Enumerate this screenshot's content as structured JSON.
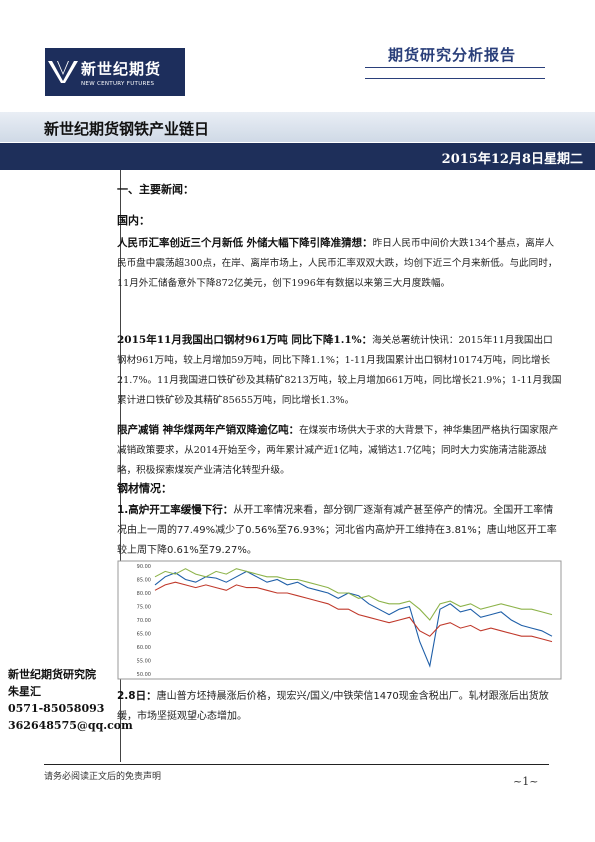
{
  "header": {
    "logo_cn": "新世纪期货",
    "logo_en": "NEW CENTURY FUTURES",
    "report_type": "期货研究分析报告"
  },
  "title": "新世纪期货钢铁产业链日",
  "date": "2015年12月8日星期二",
  "section1": {
    "heading": "一、主要新闻：",
    "domestic_label": "国内：",
    "news": [
      {
        "headline": "人民币汇率创近三个月新低 外储大幅下降引降准猜想：",
        "body": "昨日人民币中间价大跌134个基点，离岸人民币盘中震荡超300点，在岸、离岸市场上，人民币汇率双双大跌，均创下近三个月来新低。与此同时，11月外汇储备意外下降872亿美元，创下1996年有数据以来第三大月度跌幅。"
      },
      {
        "headline": "2015年11月我国出口钢材961万吨 同比下降1.1%：",
        "body": "海关总署统计快讯：2015年11月我国出口钢材961万吨，较上月增加59万吨，同比下降1.1%；1-11月我国累计出口钢材10174万吨，同比增长21.7%。11月我国进口铁矿砂及其精矿8213万吨，较上月增加661万吨，同比增长21.9%；1-11月我国累计进口铁矿砂及其精矿85655万吨，同比增长1.3%。"
      },
      {
        "headline": "限产减销 神华煤两年产销双降逾亿吨：",
        "body": "在煤炭市场供大于求的大背景下，神华集团严格执行国家限产减销政策要求，从2014开始至今，两年累计减产近1亿吨，减销达1.7亿吨；同时大力实施清洁能源战略，积极探索煤炭产业清洁化转型升级。"
      }
    ],
    "steel_label": "钢材情况：",
    "steel_items": [
      {
        "headline": "1.高炉开工率缓慢下行：",
        "body": "从开工率情况来看，部分钢厂逐渐有减产甚至停产的情况。全国开工率情况由上一周的77.49%减少了0.56%至76.93%；河北省内高炉开工维持在3.81%；唐山地区开工率较上周下降0.61%至79.27%。"
      },
      {
        "headline": "2.8日：",
        "body": "唐山普方坯持晨涨后价格，现宏兴/国义/中铁荣信1470现金含税出厂。轧材跟涨后出货放缓，市场坚挺观望心态增加。"
      }
    ]
  },
  "chart_data": {
    "type": "line",
    "title": "",
    "xlabel": "",
    "ylabel": "",
    "y_tick_labels": [
      "90.00",
      "85.00",
      "80.00",
      "75.00",
      "70.00",
      "65.00",
      "60.00",
      "55.00",
      "50.00"
    ],
    "ylim": [
      50,
      90
    ],
    "grid": false,
    "series": [
      {
        "color": "#1f5fa8",
        "values": [
          83,
          86,
          87.5,
          85,
          84,
          86,
          85.5,
          84,
          86,
          88,
          86,
          84,
          85,
          83,
          84,
          82,
          81,
          80,
          78,
          80,
          79,
          76,
          74,
          72,
          74,
          75,
          62,
          53,
          74,
          76,
          73,
          74,
          71,
          72,
          73,
          70,
          68,
          67,
          66,
          64
        ]
      },
      {
        "color": "#8db34a",
        "values": [
          86,
          88,
          87,
          89,
          87,
          86,
          88,
          87,
          89,
          88,
          87,
          86,
          86,
          85,
          85,
          84,
          83,
          82,
          80,
          80,
          78,
          79,
          77,
          76,
          76,
          77,
          74,
          70,
          76,
          77,
          75,
          76,
          74,
          75,
          76,
          75,
          74,
          74,
          73,
          72
        ]
      },
      {
        "color": "#c0392b",
        "values": [
          81,
          83,
          84,
          83,
          82,
          83,
          82,
          81,
          83,
          82,
          82,
          81,
          80,
          80,
          79,
          78,
          77,
          76,
          74,
          74,
          72,
          71,
          70,
          69,
          70,
          71,
          66,
          64,
          68,
          69,
          67,
          68,
          66,
          67,
          66,
          65,
          64,
          64,
          63,
          62
        ]
      }
    ]
  },
  "contact": {
    "org": "新世纪期货研究院",
    "name": "朱星汇",
    "phone": "0571-85058093",
    "email": "362648575@qq.com"
  },
  "footer": {
    "disclaimer": "请务必阅读正文后的免责声明",
    "page": "~1~"
  }
}
